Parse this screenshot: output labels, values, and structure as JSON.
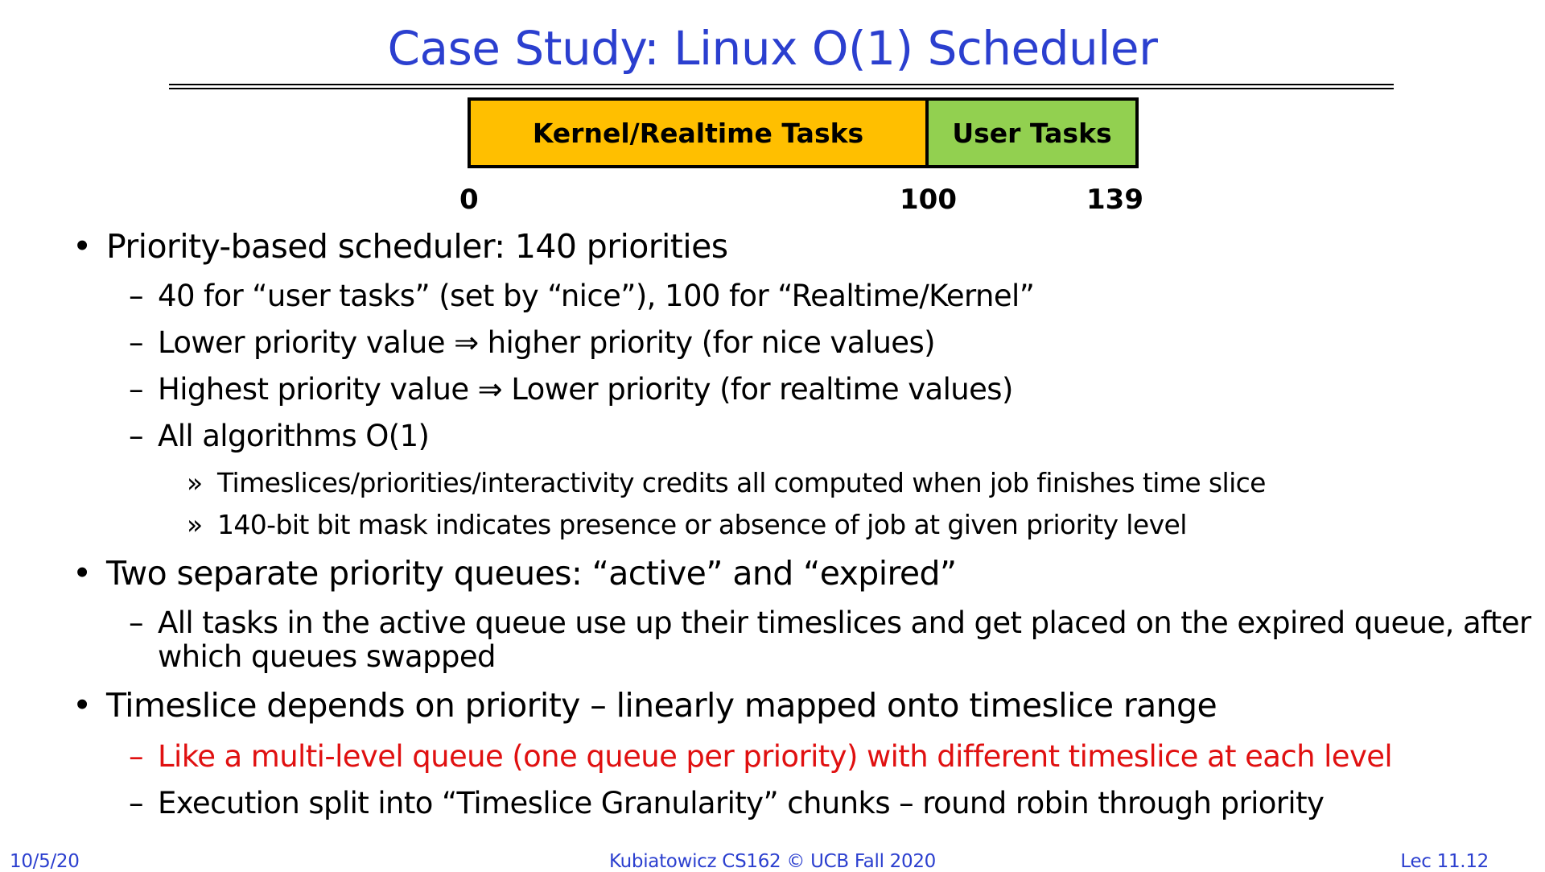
{
  "title": "Case Study: Linux O(1) Scheduler",
  "diagram": {
    "kernel_label": "Kernel/Realtime Tasks",
    "user_label": "User Tasks",
    "tick_0": "0",
    "tick_100": "100",
    "tick_139": "139",
    "colors": {
      "kernel": "#ffbf00",
      "user": "#92d050"
    }
  },
  "bullets": {
    "b1": "Priority-based scheduler: 140 priorities",
    "b1_s1": "40 for “user tasks” (set by “nice”), 100 for “Realtime/Kernel”",
    "b1_s2": "Lower priority value ⇒ higher priority (for nice values)",
    "b1_s3": "Highest priority value ⇒ Lower priority (for realtime values)",
    "b1_s4": "All algorithms O(1)",
    "b1_s4_a": "Timeslices/priorities/interactivity credits all computed when job finishes time slice",
    "b1_s4_b": "140-bit bit mask indicates presence or absence of job at given priority level",
    "b2": "Two separate priority queues: “active” and “expired”",
    "b2_s1_line1": "All tasks in the active queue use up their timeslices and get placed on the expired queue, after",
    "b2_s1_line2": "which queues swapped",
    "b3": "Timeslice depends on priority – linearly mapped onto timeslice range",
    "b3_s1": "Like a multi-level queue (one queue per priority) with different timeslice at each level",
    "b3_s2": "Execution split into “Timeslice Granularity” chunks – round robin through priority"
  },
  "markers": {
    "bullet": "•",
    "dash": "–",
    "chevron": "»"
  },
  "footer": {
    "date": "10/5/20",
    "course": "Kubiatowicz CS162 © UCB Fall 2020",
    "lecture": "Lec 11.12"
  },
  "colors": {
    "title": "#2b3fcf",
    "highlight": "#e01010"
  }
}
